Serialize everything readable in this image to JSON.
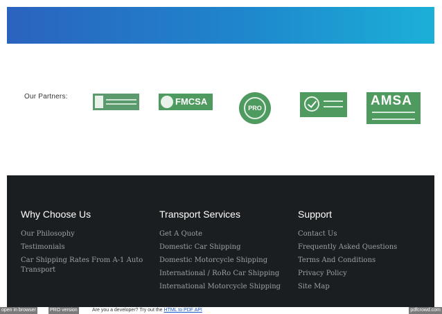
{
  "partners": {
    "label": "Our Partners:",
    "logos": [
      {
        "name": "BBB",
        "text": ""
      },
      {
        "name": "FMCSA",
        "text": "FMCSA"
      },
      {
        "name": "ProMover",
        "text": "PRO"
      },
      {
        "name": "VeriSign Secured",
        "text": ""
      },
      {
        "name": "AMSA",
        "text": "AMSA"
      }
    ]
  },
  "footer": {
    "columns": [
      {
        "title": "Why Choose Us",
        "links": [
          "Our Philosophy",
          "Testimonials",
          "Car Shipping Rates From A-1 Auto Transport"
        ]
      },
      {
        "title": "Transport Services",
        "links": [
          "Get A Quote",
          "Domestic Car Shipping",
          "Domestic Motorcycle Shipping",
          "International / RoRo Car Shipping",
          "International Motorcycle Shipping"
        ]
      },
      {
        "title": "Support",
        "links": [
          "Contact Us",
          "Frequently Asked Questions",
          "Terms And Conditions",
          "Privacy Policy",
          "Site Map"
        ]
      }
    ]
  },
  "pdfcrowd": {
    "open_label": "open in browser",
    "pro_label": "PRO version",
    "message": "Are you a developer? Try out the",
    "link_text": "HTML to PDF API",
    "brand": "pdfcrowd.com"
  },
  "colors": {
    "banner_start": "#2a63bf",
    "banner_end": "#1bb0d8",
    "footer_bg": "#1b1e20",
    "logo_green": "#4f9a5f"
  }
}
